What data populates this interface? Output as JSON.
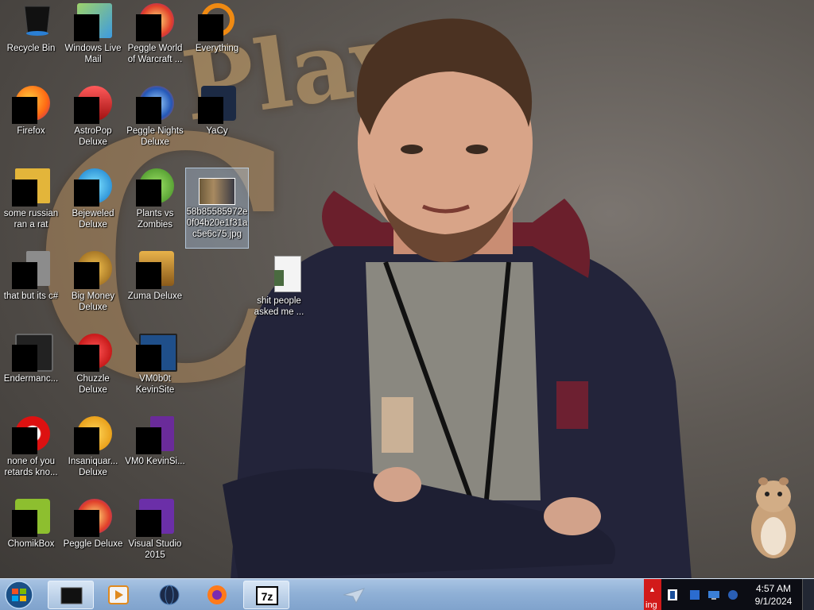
{
  "desktop": {
    "icons": [
      {
        "label": "Recycle Bin",
        "icon": "recycle-bin-icon"
      },
      {
        "label": "Windows Live Mail",
        "icon": "windows-live-mail-icon"
      },
      {
        "label": "Peggle World of Warcraft ...",
        "icon": "peggle-wow-icon"
      },
      {
        "label": "Everything",
        "icon": "everything-search-icon"
      },
      {
        "label": "Firefox",
        "icon": "firefox-icon"
      },
      {
        "label": "AstroPop Deluxe",
        "icon": "astropop-icon"
      },
      {
        "label": "Peggle Nights Deluxe",
        "icon": "peggle-nights-icon"
      },
      {
        "label": "YaCy",
        "icon": "yacy-icon"
      },
      {
        "label": "some russian ran a rat",
        "icon": "file-icon"
      },
      {
        "label": "Bejeweled Deluxe",
        "icon": "bejeweled-icon"
      },
      {
        "label": "Plants vs Zombies",
        "icon": "plants-vs-zombies-icon"
      },
      {
        "label": "58b85585972e0f04b20e1f31ac5e6c75.jpg",
        "icon": "jpg-image-icon"
      },
      {
        "label": "that but its c#",
        "icon": "file-icon"
      },
      {
        "label": "Big Money Deluxe",
        "icon": "big-money-icon"
      },
      {
        "label": "Zuma Deluxe",
        "icon": "zuma-icon"
      },
      {
        "label": "shit people asked me ...",
        "icon": "text-file-icon"
      },
      {
        "label": "Endermanc...",
        "icon": "app-icon"
      },
      {
        "label": "Chuzzle Deluxe",
        "icon": "chuzzle-icon"
      },
      {
        "label": "VM0b0t KevinSite",
        "icon": "shortcut-icon"
      },
      {
        "label": "none of you retards kno...",
        "icon": "app-icon"
      },
      {
        "label": "Insaniquar... Deluxe",
        "icon": "insaniquarium-icon"
      },
      {
        "label": "VM0 KevinSi...",
        "icon": "shortcut-icon"
      },
      {
        "label": "ChomikBox",
        "icon": "chomikbox-icon"
      },
      {
        "label": "Peggle Deluxe",
        "icon": "peggle-icon"
      },
      {
        "label": "Visual Studio 2015",
        "icon": "visual-studio-icon"
      }
    ],
    "wallpaper_text": "Play"
  },
  "taskbar": {
    "start": "start-orb-icon",
    "pinned": [
      {
        "icon": "terminal-window-icon",
        "active": true
      },
      {
        "icon": "media-player-icon",
        "active": false
      },
      {
        "icon": "globe-icon",
        "active": false
      },
      {
        "icon": "firefox-icon",
        "active": false
      },
      {
        "icon": "7zip-icon",
        "active": true
      }
    ],
    "tray_text": "ing",
    "clock": {
      "time": "4:57 AM",
      "date": "9/1/2024"
    }
  },
  "colors": {
    "taskbar": "#8fb0d6",
    "tray": "#0c0d14",
    "desktop": "#5e5954"
  }
}
